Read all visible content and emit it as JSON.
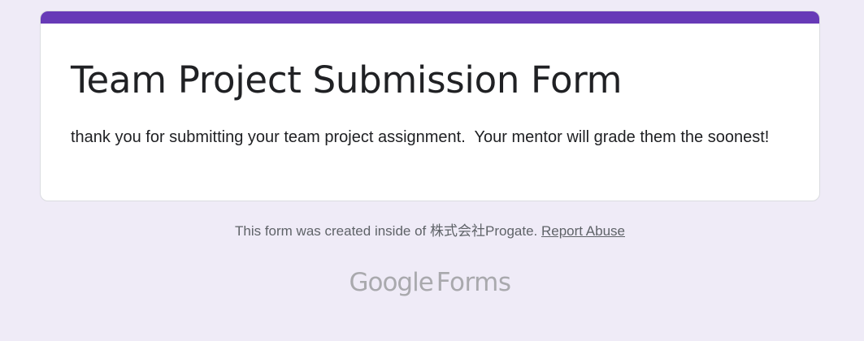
{
  "form": {
    "title": "Team Project Submission Form",
    "description": "thank you for submitting your team project assignment.  Your mentor will grade them the soonest!",
    "accent_color": "#673ab7"
  },
  "footer": {
    "created_text": "This form was created inside of 株式会社Progate.",
    "report_link": "Report Abuse"
  },
  "brand": {
    "google": "Google",
    "product": "Forms"
  },
  "colors": {
    "background": "#efebf7",
    "card": "#ffffff",
    "text": "#202124",
    "muted": "#5f6368",
    "logo": "#a9a9ad"
  }
}
